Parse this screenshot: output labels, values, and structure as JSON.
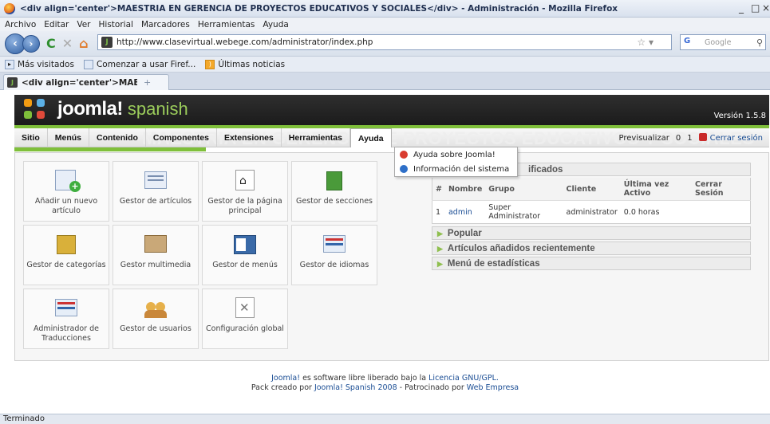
{
  "window": {
    "title": "<div align='center'>MAESTRIA EN GERENCIA DE PROYECTOS EDUCATIVOS Y SOCIALES</div> - Administración - Mozilla Firefox",
    "min_btn": "_",
    "max_btn": "□",
    "close_btn": "×"
  },
  "browser_menu": [
    "Archivo",
    "Editar",
    "Ver",
    "Historial",
    "Marcadores",
    "Herramientas",
    "Ayuda"
  ],
  "nav": {
    "back": "‹",
    "forward": "›",
    "reload": "C",
    "stop": "✕",
    "home": "⌂",
    "url": "http://www.clasevirtual.webege.com/administrator/index.php",
    "search_engine": "G",
    "search_placeholder": "Google",
    "star": "☆ ▾",
    "magnifier": "⚲"
  },
  "bookmarks": [
    "Más visitados",
    "Comenzar a usar Firef...",
    "Últimas noticias"
  ],
  "tab": {
    "label": "<div align='center'>MAESTRIA EN G...",
    "new_tab": "+"
  },
  "joomla": {
    "logo_text": "joomla!",
    "logo_sub": "spanish",
    "version": "Versión 1.5.8",
    "watermark": "MAESTRIA EN GERENCIA DE PROYECTOS EDUCATIVOS Y SOCIALES"
  },
  "admin_menu": [
    {
      "label": "Sitio"
    },
    {
      "label": "Menús"
    },
    {
      "label": "Contenido"
    },
    {
      "label": "Componentes"
    },
    {
      "label": "Extensiones"
    },
    {
      "label": "Herramientas"
    },
    {
      "label": "Ayuda"
    }
  ],
  "admin_right": {
    "preview": "Previsualizar",
    "messages": "0",
    "users": "1",
    "logout": "Cerrar sesión"
  },
  "help_dropdown": [
    {
      "label": "Ayuda sobre Joomla!"
    },
    {
      "label": "Información del sistema"
    }
  ],
  "cpanel": [
    {
      "label": "Añadir un nuevo artículo",
      "icon": "add-article-icon"
    },
    {
      "label": "Gestor de artículos",
      "icon": "articles-icon"
    },
    {
      "label": "Gestor de la página principal",
      "icon": "frontpage-icon"
    },
    {
      "label": "Gestor de secciones",
      "icon": "sections-icon"
    },
    {
      "label": "Gestor de categorías",
      "icon": "categories-icon"
    },
    {
      "label": "Gestor multimedia",
      "icon": "media-icon"
    },
    {
      "label": "Gestor de menús",
      "icon": "menus-icon"
    },
    {
      "label": "Gestor de idiomas",
      "icon": "languages-icon"
    },
    {
      "label": "Administrador de Traducciones",
      "icon": "translations-icon"
    },
    {
      "label": "Gestor de usuarios",
      "icon": "users-icon"
    },
    {
      "label": "Configuración global",
      "icon": "config-icon"
    }
  ],
  "logged_module": {
    "title_visible": "ificados",
    "columns": [
      "#",
      "Nombre",
      "Grupo",
      "Cliente",
      "Última vez Activo",
      "Cerrar Sesión"
    ],
    "rows": [
      {
        "num": "1",
        "name": "admin",
        "group": "Super Administrator",
        "client": "administrator",
        "last": "0.0 horas",
        "logout": ""
      }
    ]
  },
  "modules": [
    "Popular",
    "Artículos añadidos recientemente",
    "Menú de estadísticas"
  ],
  "footer": {
    "line1_link": "Joomla!",
    "line1_text": " es software libre liberado bajo la ",
    "line1_link2": "Licencia GNU/GPL.",
    "line2_text1": "Pack creado por ",
    "line2_link1": "Joomla! Spanish 2008",
    "line2_text2": " - Patrocinado por ",
    "line2_link2": "Web Empresa"
  },
  "status": "Terminado"
}
